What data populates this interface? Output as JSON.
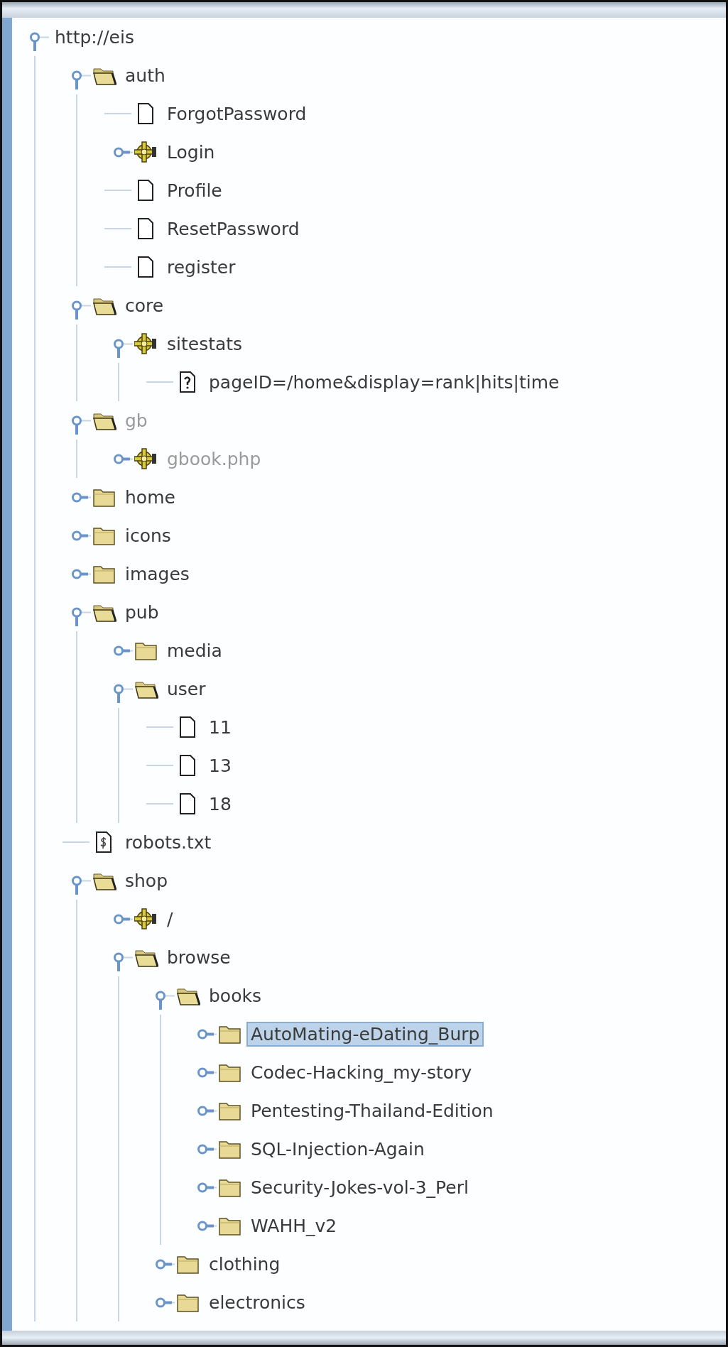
{
  "site_tree": {
    "label": "http://eis",
    "expanded": true,
    "selected": false,
    "requested": true,
    "children": [
      {
        "label": "auth",
        "kind": "folder",
        "expanded": true,
        "selected": false,
        "requested": true,
        "children": [
          {
            "label": "ForgotPassword",
            "kind": "file",
            "selected": false,
            "requested": true
          },
          {
            "label": "Login",
            "kind": "script",
            "expanded": false,
            "selected": false,
            "requested": true
          },
          {
            "label": "Profile",
            "kind": "file",
            "selected": false,
            "requested": true
          },
          {
            "label": "ResetPassword",
            "kind": "file",
            "selected": false,
            "requested": true
          },
          {
            "label": "register",
            "kind": "file",
            "selected": false,
            "requested": true
          }
        ]
      },
      {
        "label": "core",
        "kind": "folder",
        "expanded": true,
        "selected": false,
        "requested": true,
        "children": [
          {
            "label": "sitestats",
            "kind": "script",
            "expanded": true,
            "selected": false,
            "requested": true,
            "children": [
              {
                "label": "pageID=/home&display=rank|hits|time",
                "kind": "query",
                "selected": false,
                "requested": true
              }
            ]
          }
        ]
      },
      {
        "label": "gb",
        "kind": "folder",
        "expanded": true,
        "selected": false,
        "requested": false,
        "children": [
          {
            "label": "gbook.php",
            "kind": "script",
            "expanded": false,
            "selected": false,
            "requested": false
          }
        ]
      },
      {
        "label": "home",
        "kind": "folder",
        "expanded": false,
        "selected": false,
        "requested": true
      },
      {
        "label": "icons",
        "kind": "folder",
        "expanded": false,
        "selected": false,
        "requested": true
      },
      {
        "label": "images",
        "kind": "folder",
        "expanded": false,
        "selected": false,
        "requested": true
      },
      {
        "label": "pub",
        "kind": "folder",
        "expanded": true,
        "selected": false,
        "requested": true,
        "children": [
          {
            "label": "media",
            "kind": "folder",
            "expanded": false,
            "selected": false,
            "requested": true
          },
          {
            "label": "user",
            "kind": "folder",
            "expanded": true,
            "selected": false,
            "requested": true,
            "children": [
              {
                "label": "11",
                "kind": "file",
                "selected": false,
                "requested": true
              },
              {
                "label": "13",
                "kind": "file",
                "selected": false,
                "requested": true
              },
              {
                "label": "18",
                "kind": "file",
                "selected": false,
                "requested": true
              }
            ]
          }
        ]
      },
      {
        "label": "robots.txt",
        "kind": "text",
        "selected": false,
        "requested": true
      },
      {
        "label": "shop",
        "kind": "folder",
        "expanded": true,
        "selected": false,
        "requested": true,
        "children": [
          {
            "label": "/",
            "kind": "script",
            "expanded": false,
            "selected": false,
            "requested": true
          },
          {
            "label": "browse",
            "kind": "folder",
            "expanded": true,
            "selected": false,
            "requested": true,
            "children": [
              {
                "label": "books",
                "kind": "folder",
                "expanded": true,
                "selected": false,
                "requested": true,
                "children": [
                  {
                    "label": "AutoMating-eDating_Burp",
                    "kind": "folder",
                    "expanded": false,
                    "selected": true,
                    "requested": true
                  },
                  {
                    "label": "Codec-Hacking_my-story",
                    "kind": "folder",
                    "expanded": false,
                    "selected": false,
                    "requested": true
                  },
                  {
                    "label": "Pentesting-Thailand-Edition",
                    "kind": "folder",
                    "expanded": false,
                    "selected": false,
                    "requested": true
                  },
                  {
                    "label": "SQL-Injection-Again",
                    "kind": "folder",
                    "expanded": false,
                    "selected": false,
                    "requested": true
                  },
                  {
                    "label": "Security-Jokes-vol-3_Perl",
                    "kind": "folder",
                    "expanded": false,
                    "selected": false,
                    "requested": true
                  },
                  {
                    "label": "WAHH_v2",
                    "kind": "folder",
                    "expanded": false,
                    "selected": false,
                    "requested": true
                  }
                ]
              },
              {
                "label": "clothing",
                "kind": "folder",
                "expanded": false,
                "selected": false,
                "requested": true
              },
              {
                "label": "electronics",
                "kind": "folder",
                "expanded": false,
                "selected": false,
                "requested": true
              }
            ]
          }
        ]
      }
    ]
  }
}
